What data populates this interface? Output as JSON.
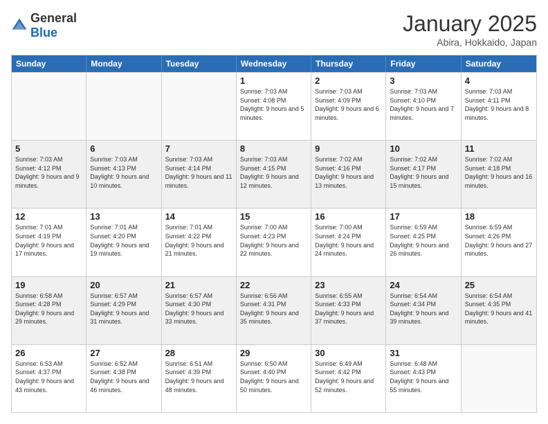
{
  "logo": {
    "general": "General",
    "blue": "Blue"
  },
  "title": "January 2025",
  "location": "Abira, Hokkaido, Japan",
  "weekdays": [
    "Sunday",
    "Monday",
    "Tuesday",
    "Wednesday",
    "Thursday",
    "Friday",
    "Saturday"
  ],
  "rows": [
    [
      {
        "day": "",
        "text": "",
        "empty": true
      },
      {
        "day": "",
        "text": "",
        "empty": true
      },
      {
        "day": "",
        "text": "",
        "empty": true
      },
      {
        "day": "1",
        "text": "Sunrise: 7:03 AM\nSunset: 4:08 PM\nDaylight: 9 hours and 5 minutes."
      },
      {
        "day": "2",
        "text": "Sunrise: 7:03 AM\nSunset: 4:09 PM\nDaylight: 9 hours and 6 minutes."
      },
      {
        "day": "3",
        "text": "Sunrise: 7:03 AM\nSunset: 4:10 PM\nDaylight: 9 hours and 7 minutes."
      },
      {
        "day": "4",
        "text": "Sunrise: 7:03 AM\nSunset: 4:11 PM\nDaylight: 9 hours and 8 minutes."
      }
    ],
    [
      {
        "day": "5",
        "text": "Sunrise: 7:03 AM\nSunset: 4:12 PM\nDaylight: 9 hours and 9 minutes.",
        "shaded": true
      },
      {
        "day": "6",
        "text": "Sunrise: 7:03 AM\nSunset: 4:13 PM\nDaylight: 9 hours and 10 minutes.",
        "shaded": true
      },
      {
        "day": "7",
        "text": "Sunrise: 7:03 AM\nSunset: 4:14 PM\nDaylight: 9 hours and 11 minutes.",
        "shaded": true
      },
      {
        "day": "8",
        "text": "Sunrise: 7:03 AM\nSunset: 4:15 PM\nDaylight: 9 hours and 12 minutes.",
        "shaded": true
      },
      {
        "day": "9",
        "text": "Sunrise: 7:02 AM\nSunset: 4:16 PM\nDaylight: 9 hours and 13 minutes.",
        "shaded": true
      },
      {
        "day": "10",
        "text": "Sunrise: 7:02 AM\nSunset: 4:17 PM\nDaylight: 9 hours and 15 minutes.",
        "shaded": true
      },
      {
        "day": "11",
        "text": "Sunrise: 7:02 AM\nSunset: 4:18 PM\nDaylight: 9 hours and 16 minutes.",
        "shaded": true
      }
    ],
    [
      {
        "day": "12",
        "text": "Sunrise: 7:01 AM\nSunset: 4:19 PM\nDaylight: 9 hours and 17 minutes."
      },
      {
        "day": "13",
        "text": "Sunrise: 7:01 AM\nSunset: 4:20 PM\nDaylight: 9 hours and 19 minutes."
      },
      {
        "day": "14",
        "text": "Sunrise: 7:01 AM\nSunset: 4:22 PM\nDaylight: 9 hours and 21 minutes."
      },
      {
        "day": "15",
        "text": "Sunrise: 7:00 AM\nSunset: 4:23 PM\nDaylight: 9 hours and 22 minutes."
      },
      {
        "day": "16",
        "text": "Sunrise: 7:00 AM\nSunset: 4:24 PM\nDaylight: 9 hours and 24 minutes."
      },
      {
        "day": "17",
        "text": "Sunrise: 6:59 AM\nSunset: 4:25 PM\nDaylight: 9 hours and 26 minutes."
      },
      {
        "day": "18",
        "text": "Sunrise: 6:59 AM\nSunset: 4:26 PM\nDaylight: 9 hours and 27 minutes."
      }
    ],
    [
      {
        "day": "19",
        "text": "Sunrise: 6:58 AM\nSunset: 4:28 PM\nDaylight: 9 hours and 29 minutes.",
        "shaded": true
      },
      {
        "day": "20",
        "text": "Sunrise: 6:57 AM\nSunset: 4:29 PM\nDaylight: 9 hours and 31 minutes.",
        "shaded": true
      },
      {
        "day": "21",
        "text": "Sunrise: 6:57 AM\nSunset: 4:30 PM\nDaylight: 9 hours and 33 minutes.",
        "shaded": true
      },
      {
        "day": "22",
        "text": "Sunrise: 6:56 AM\nSunset: 4:31 PM\nDaylight: 9 hours and 35 minutes.",
        "shaded": true
      },
      {
        "day": "23",
        "text": "Sunrise: 6:55 AM\nSunset: 4:33 PM\nDaylight: 9 hours and 37 minutes.",
        "shaded": true
      },
      {
        "day": "24",
        "text": "Sunrise: 6:54 AM\nSunset: 4:34 PM\nDaylight: 9 hours and 39 minutes.",
        "shaded": true
      },
      {
        "day": "25",
        "text": "Sunrise: 6:54 AM\nSunset: 4:35 PM\nDaylight: 9 hours and 41 minutes.",
        "shaded": true
      }
    ],
    [
      {
        "day": "26",
        "text": "Sunrise: 6:53 AM\nSunset: 4:37 PM\nDaylight: 9 hours and 43 minutes."
      },
      {
        "day": "27",
        "text": "Sunrise: 6:52 AM\nSunset: 4:38 PM\nDaylight: 9 hours and 46 minutes."
      },
      {
        "day": "28",
        "text": "Sunrise: 6:51 AM\nSunset: 4:39 PM\nDaylight: 9 hours and 48 minutes."
      },
      {
        "day": "29",
        "text": "Sunrise: 6:50 AM\nSunset: 4:40 PM\nDaylight: 9 hours and 50 minutes."
      },
      {
        "day": "30",
        "text": "Sunrise: 6:49 AM\nSunset: 4:42 PM\nDaylight: 9 hours and 52 minutes."
      },
      {
        "day": "31",
        "text": "Sunrise: 6:48 AM\nSunset: 4:43 PM\nDaylight: 9 hours and 55 minutes."
      },
      {
        "day": "",
        "text": "",
        "empty": true
      }
    ]
  ]
}
